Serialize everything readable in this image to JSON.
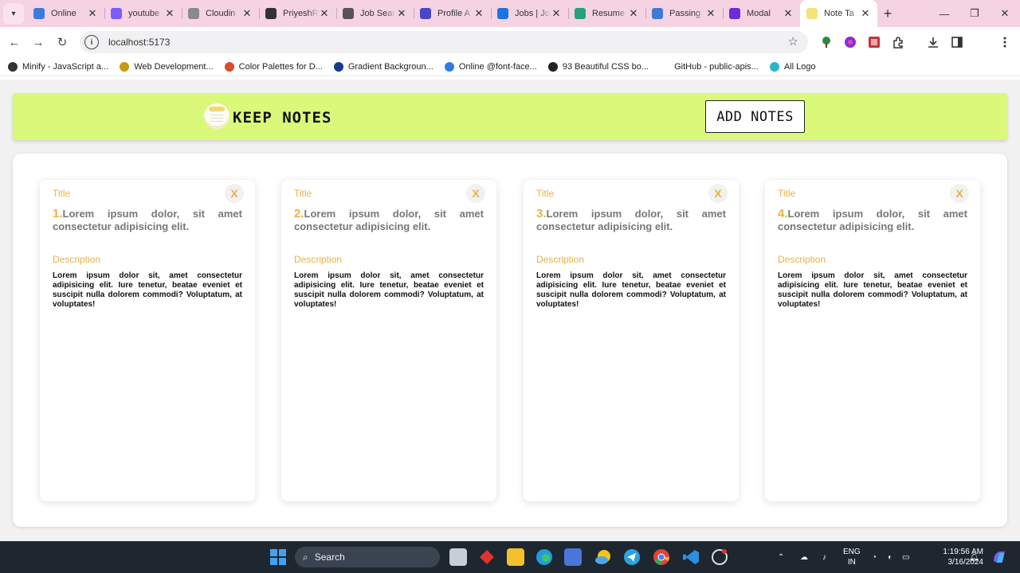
{
  "browser": {
    "tabs": [
      {
        "label": "Online",
        "color": "#3b7be0"
      },
      {
        "label": "youtube",
        "color": "#7c5cff"
      },
      {
        "label": "Cloudin",
        "color": "#8a8a8a"
      },
      {
        "label": "PriyeshR",
        "color": "#333333"
      },
      {
        "label": "Job Sear",
        "color": "#555555"
      },
      {
        "label": "Profile A",
        "color": "#4a46c8"
      },
      {
        "label": "Jobs | Jo",
        "color": "#1b74e4"
      },
      {
        "label": "Resume",
        "color": "#23a37a"
      },
      {
        "label": "Passing",
        "color": "#3f7bd6"
      },
      {
        "label": "Modal",
        "color": "#6f2bd6"
      },
      {
        "label": "Note Ta",
        "color": "#f6e27a",
        "active": true
      }
    ],
    "close_glyph": "✕",
    "new_tab_glyph": "+",
    "url": "localhost:5173",
    "bookmarks": [
      {
        "label": "Minify - JavaScript a...",
        "color": "#333333"
      },
      {
        "label": "Web Development...",
        "color": "#c99a12"
      },
      {
        "label": "Color Palettes for D...",
        "color": "#d94b2b"
      },
      {
        "label": "Gradient Backgroun...",
        "color": "#1a3a8f"
      },
      {
        "label": "Online @font-face...",
        "color": "#2f7de0"
      },
      {
        "label": "93 Beautiful CSS bo...",
        "color": "#222222"
      },
      {
        "label": "GitHub - public-apis...",
        "color": "#ffffff"
      },
      {
        "label": "All Logo",
        "color": "#2bb5c9"
      }
    ]
  },
  "app": {
    "brand": "KEEP NOTES",
    "add_button": "ADD NOTES",
    "notes": [
      {
        "title_label": "Title",
        "number": "1.",
        "title": "Lorem ipsum dolor, sit amet consectetur adipisicing elit.",
        "desc_label": "Description",
        "description": "Lorem ipsum dolor sit, amet consectetur adipisicing elit. Iure tenetur, beatae eveniet et suscipit nulla dolorem commodi? Voluptatum, at voluptates!",
        "close": "X"
      },
      {
        "title_label": "Title",
        "number": "2.",
        "title": "Lorem ipsum dolor, sit amet consectetur adipisicing elit.",
        "desc_label": "Description",
        "description": "Lorem ipsum dolor sit, amet consectetur adipisicing elit. Iure tenetur, beatae eveniet et suscipit nulla dolorem commodi? Voluptatum, at voluptates!",
        "close": "X"
      },
      {
        "title_label": "Title",
        "number": "3.",
        "title": "Lorem ipsum dolor, sit amet consectetur adipisicing elit.",
        "desc_label": "Description",
        "description": "Lorem ipsum dolor sit, amet consectetur adipisicing elit. Iure tenetur, beatae eveniet et suscipit nulla dolorem commodi? Voluptatum, at voluptates!",
        "close": "X"
      },
      {
        "title_label": "Title",
        "number": "4.",
        "title": "Lorem ipsum dolor, sit amet consectetur adipisicing elit.",
        "desc_label": "Description",
        "description": "Lorem ipsum dolor sit, amet consectetur adipisicing elit. Iure tenetur, beatae eveniet et suscipit nulla dolorem commodi? Voluptatum, at voluptates!",
        "close": "X"
      }
    ],
    "colors": {
      "header_bg": "#daf97b",
      "accent": "#e9b14a"
    }
  },
  "taskbar": {
    "search_label": "Search",
    "lang_line1": "ENG",
    "lang_line2": "IN",
    "time": "1:19:56 AM",
    "date": "3/16/2024"
  }
}
